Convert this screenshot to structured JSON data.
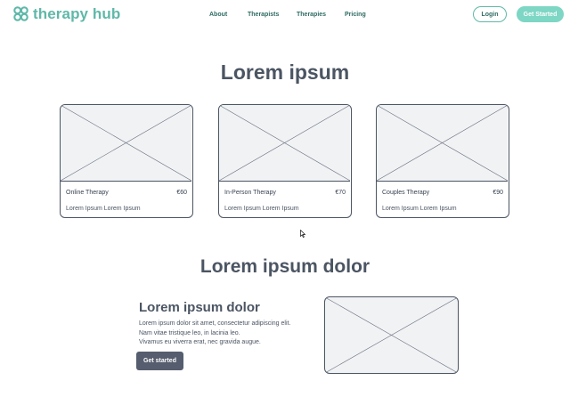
{
  "header": {
    "brand": "therapy hub",
    "logo_icon": "knot-logo-icon",
    "nav": [
      "About",
      "Therapists",
      "Therapies",
      "Pricing"
    ],
    "login_label": "Login",
    "get_started_label": "Get Started"
  },
  "colors": {
    "brand": "#5fb8a8",
    "brand_light": "#7ed6c4",
    "text": "#4b5563",
    "button_dark": "#555d6e",
    "placeholder_bg": "#f1f2f4"
  },
  "section1": {
    "title": "Lorem ipsum",
    "cards": [
      {
        "name": "Online Therapy",
        "price": "€60",
        "desc": "Lorem Ipsum Lorem Ipsum"
      },
      {
        "name": "In-Person Therapy",
        "price": "€70",
        "desc": "Lorem Ipsum Lorem Ipsum"
      },
      {
        "name": "Couples Therapy",
        "price": "€90",
        "desc": "Lorem Ipsum Lorem Ipsum"
      }
    ]
  },
  "section2": {
    "title": "Lorem ipsum dolor",
    "heading": "Lorem ipsum dolor",
    "lines": [
      "Lorem ipsum dolor sit amet, consectetur adipiscing elit.",
      "Nam vitae tristique leo, in lacinia leo.",
      "Vivamus eu viverra erat, nec gravida augue."
    ],
    "button_label": "Get started"
  }
}
